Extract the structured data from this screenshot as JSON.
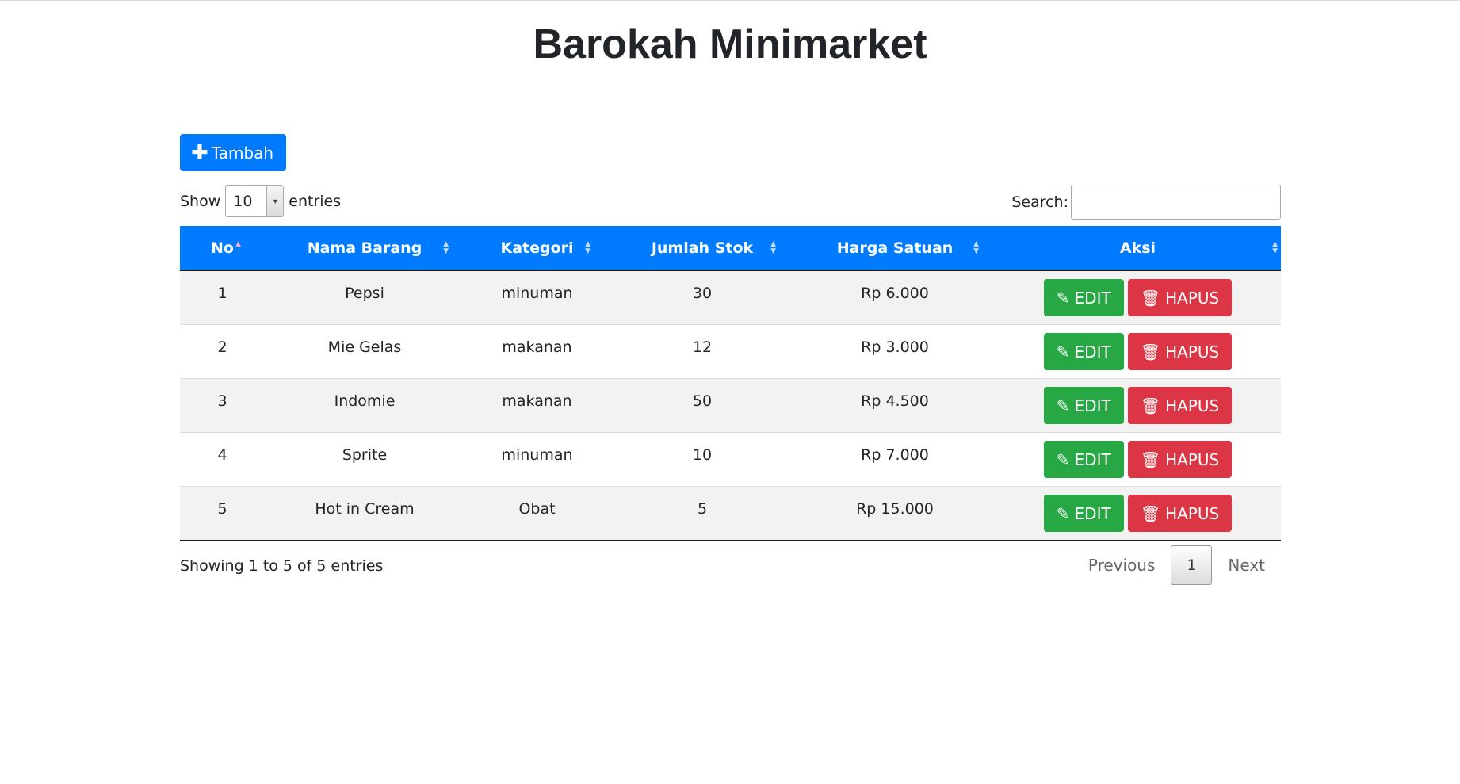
{
  "page": {
    "title": "Barokah Minimarket"
  },
  "toolbar": {
    "add_label": "Tambah"
  },
  "length_control": {
    "show_label": "Show",
    "selected": "10",
    "entries_label": "entries"
  },
  "search": {
    "label": "Search:",
    "value": ""
  },
  "table": {
    "columns": [
      "No",
      "Nama Barang",
      "Kategori",
      "Jumlah Stok",
      "Harga Satuan",
      "Aksi"
    ],
    "sorted_column": "No",
    "rows": [
      {
        "no": "1",
        "nama": "Pepsi",
        "kategori": "minuman",
        "stok": "30",
        "harga": "Rp 6.000"
      },
      {
        "no": "2",
        "nama": "Mie Gelas",
        "kategori": "makanan",
        "stok": "12",
        "harga": "Rp 3.000"
      },
      {
        "no": "3",
        "nama": "Indomie",
        "kategori": "makanan",
        "stok": "50",
        "harga": "Rp 4.500"
      },
      {
        "no": "4",
        "nama": "Sprite",
        "kategori": "minuman",
        "stok": "10",
        "harga": "Rp 7.000"
      },
      {
        "no": "5",
        "nama": "Hot in Cream",
        "kategori": "Obat",
        "stok": "5",
        "harga": "Rp 15.000"
      }
    ],
    "edit_label": "EDIT",
    "delete_label": "HAPUS"
  },
  "footer": {
    "info": "Showing 1 to 5 of 5 entries",
    "previous": "Previous",
    "current_page": "1",
    "next": "Next"
  },
  "colors": {
    "primary": "#007bff",
    "success": "#28a745",
    "danger": "#dc3545"
  },
  "icons": {
    "add": "plus-icon",
    "edit": "pencil-icon",
    "delete": "trash-icon",
    "sort": "sort-icon",
    "dropdown": "chevron-down-icon"
  }
}
